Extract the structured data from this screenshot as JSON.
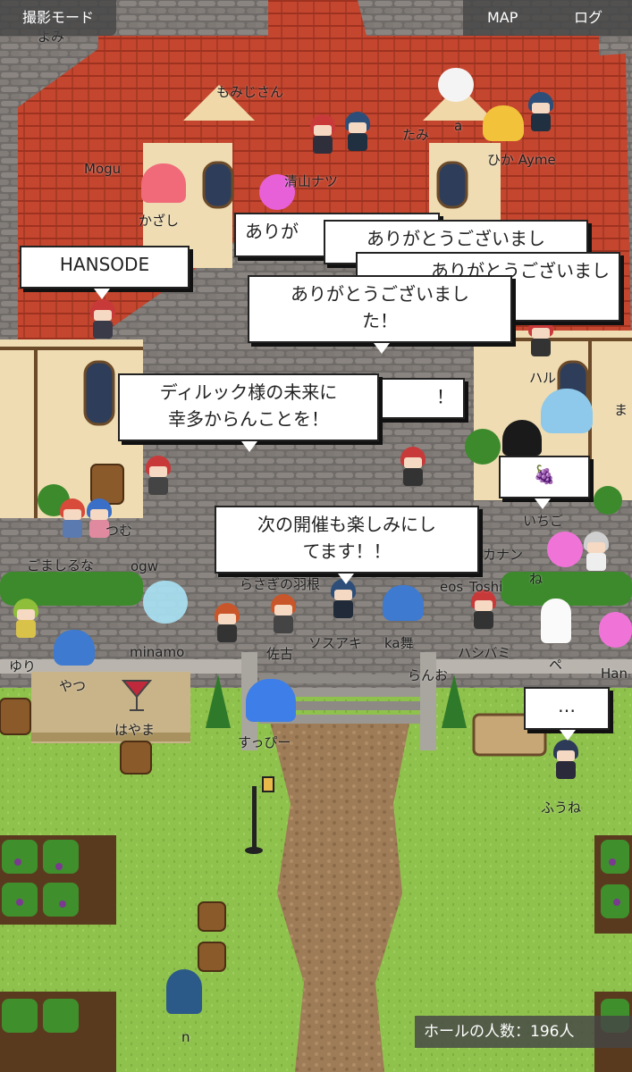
{
  "top_bar": {
    "photo_mode_label": "撮影モード",
    "map_label": "MAP",
    "log_label": "ログ"
  },
  "bubbles": {
    "hansode": "HANSODE",
    "arigato_short": "ありが",
    "arigato_b": "ありがとうございまし",
    "arigato_c": "ありがとうございまし",
    "arigato_front_l1": "ありがとうございまし",
    "arigato_front_l2": "た！",
    "exclaim": "！",
    "diluc_l1": "ディルック様の未来に",
    "diluc_l2": "幸多からんことを！",
    "next_l1": "次の開催も楽しみにし",
    "next_l2": "てます！！",
    "grape": "🍇",
    "dots": "…"
  },
  "names": {
    "mogu": "Mogu",
    "tami": "たみ",
    "hyka": "ひか Ayme",
    "kimiji": "もみじさん",
    "kazashi": "かざし",
    "a": "a",
    "tomoyama": "清山ナツ",
    "hal": "ハル",
    "ma": "ま",
    "gomashi": "ごましるな",
    "ogw": "ogw",
    "tsumu": "つむ",
    "sagi": "らさぎの羽根",
    "kei": "eos",
    "tosh": "Toshi",
    "kanon": "カナン",
    "ne": "ね",
    "ichigo": "いちご",
    "minamo": "minamo",
    "sako": "佐古",
    "ayame": "ソスアキ",
    "kaji": "ka舞",
    "hashibami": "ハシバミ",
    "pe": "ペ",
    "hai": "Han",
    "yuri": "ゆり",
    "yatsu": "やつ",
    "hayama": "はやま",
    "suppi": "すっぴー",
    "ranna": "らんお",
    "fune": "ふうね",
    "n": "n",
    "yomi": "よみ"
  },
  "hud": {
    "hall_count": "ホールの人数：196人"
  },
  "colors": {
    "roof": "#c0432f",
    "grass": "#8cbe4a",
    "cobble": "#7a7470",
    "path": "#a0805a",
    "hud_bg": "#464646"
  }
}
